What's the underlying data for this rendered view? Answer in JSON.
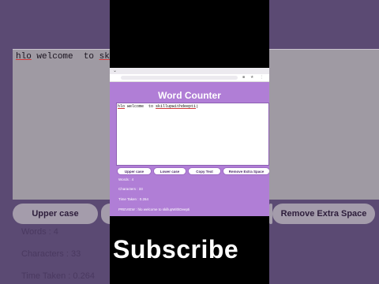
{
  "background_view": {
    "text_value": "hlo welcome  to sk",
    "text_value_underlined_prefix": "hlo",
    "buttons": {
      "upper_case": "Upper case",
      "remove_extra_space": "Remove Extra Space"
    },
    "stats": {
      "words": "Words : 4",
      "characters": "Characters : 33",
      "time_taken": "Time Taken : 0.264"
    }
  },
  "overlay": {
    "subscribe": "Subscribe"
  },
  "browser": {
    "app": {
      "title": "Word Counter",
      "textarea_value": "hlo welcome  to skillupwithdeepti",
      "buttons": {
        "upper_case": "Upper case",
        "lower_case": "Lower case",
        "copy_text": "Copy Text",
        "remove_extra_space": "Remove Extra Space"
      },
      "stats": {
        "words": "Words : 4",
        "characters": "Characters : 33",
        "time_taken": "Time Taken : 0.264",
        "preview": "PREVIEW : hlo welcome to skillupWithDeepti"
      }
    },
    "icons": {
      "tab": "chevron-icon",
      "toolbar": [
        "extension-icon",
        "bookmark-icon",
        "menu-icon"
      ]
    }
  },
  "colors": {
    "side_background": "#5b4a73",
    "app_background": "#b07ed6",
    "text_white": "#ffffff"
  }
}
